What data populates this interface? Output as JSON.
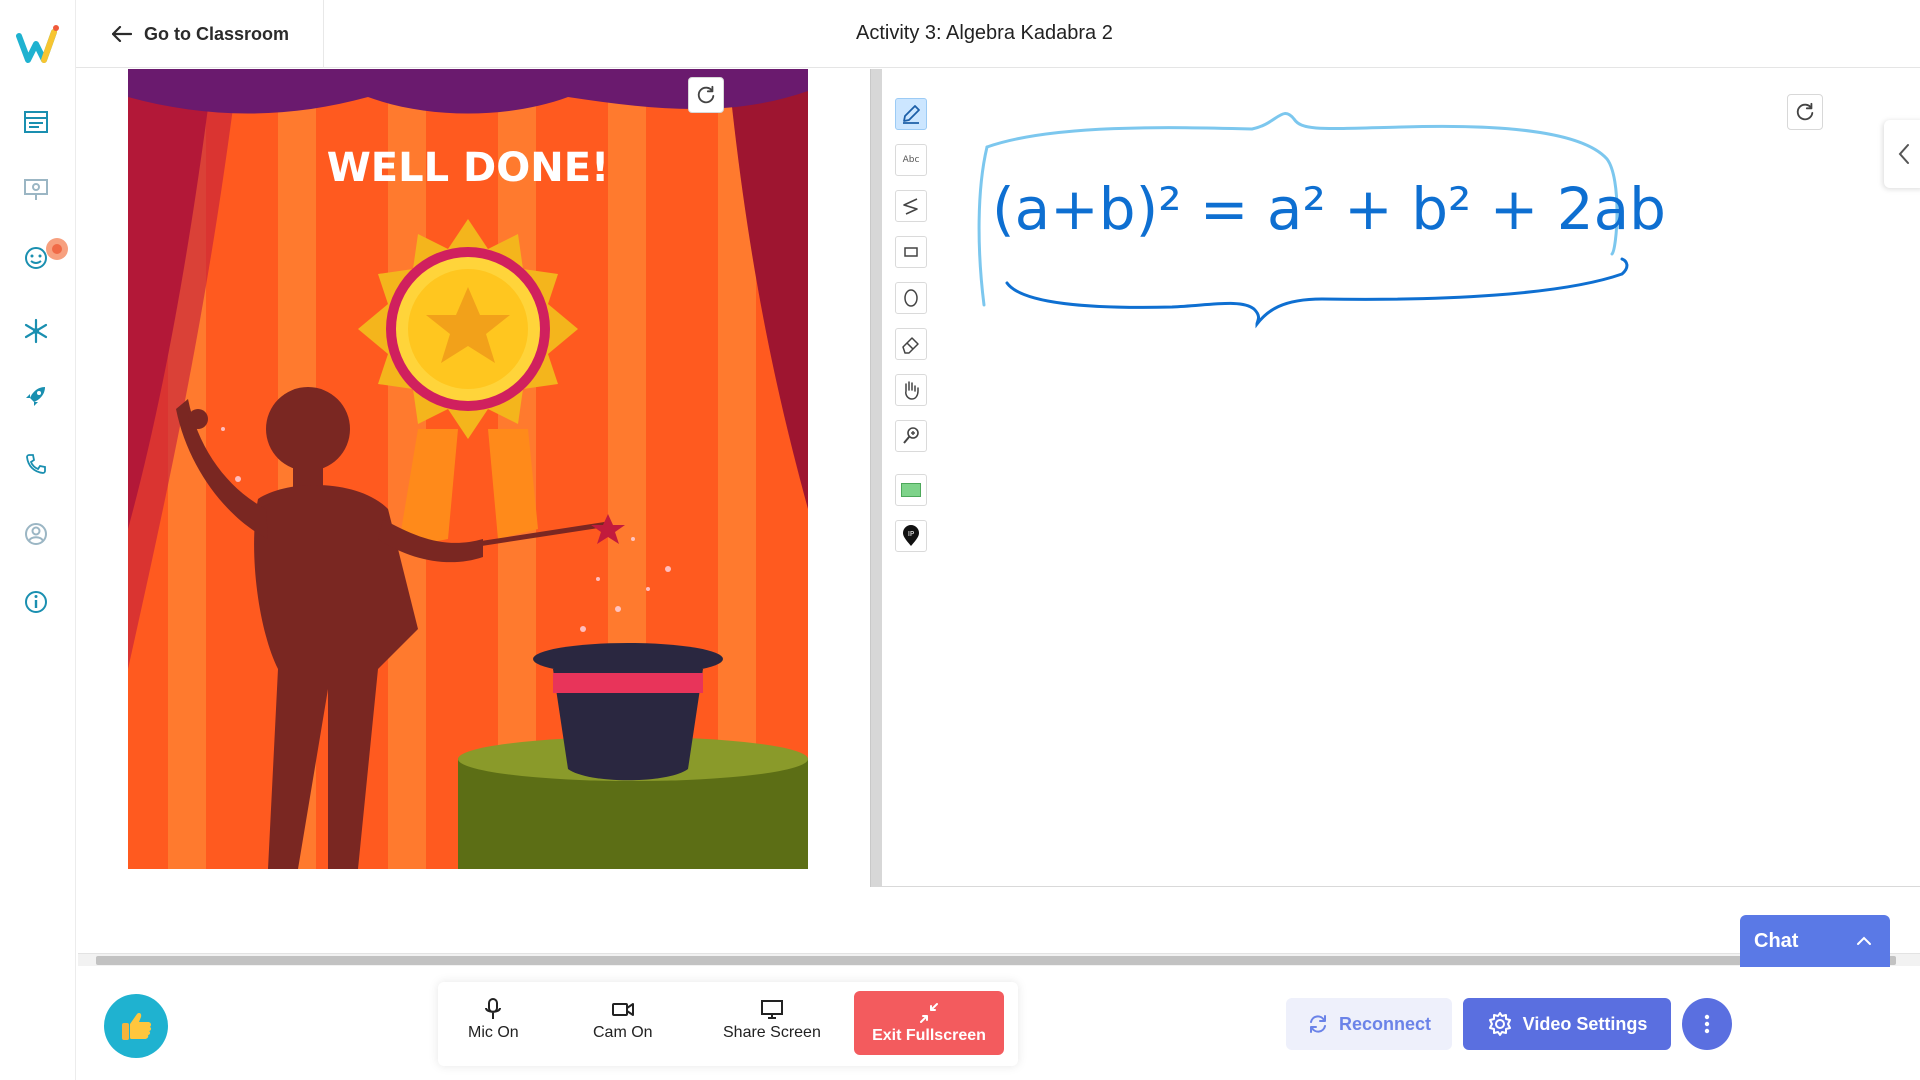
{
  "header": {
    "back_label": "Go to Classroom",
    "activity_title": "Activity 3: Algebra Kadabra 2"
  },
  "sidebar": {
    "items": [
      {
        "icon": "schedule-icon"
      },
      {
        "icon": "presentation-icon"
      },
      {
        "icon": "smiley-icon"
      },
      {
        "icon": "snowflake-icon"
      },
      {
        "icon": "rocket-icon"
      },
      {
        "icon": "phone-icon"
      },
      {
        "icon": "profile-icon"
      },
      {
        "icon": "info-icon"
      }
    ]
  },
  "activity": {
    "banner_text": "WELL DONE!"
  },
  "whiteboard": {
    "tools": [
      {
        "icon": "pencil-icon",
        "label": ""
      },
      {
        "icon": "text-tool-icon",
        "label": "Abc"
      },
      {
        "icon": "line-icon",
        "label": ""
      },
      {
        "icon": "rectangle-icon",
        "label": ""
      },
      {
        "icon": "ellipse-icon",
        "label": ""
      },
      {
        "icon": "eraser-icon",
        "label": ""
      },
      {
        "icon": "hand-icon",
        "label": ""
      },
      {
        "icon": "zoom-icon",
        "label": ""
      },
      {
        "icon": "color-swatch-icon",
        "label": ""
      },
      {
        "icon": "location-pin-icon",
        "label": "IP"
      }
    ],
    "handwritten_text": "(a+b)² = a² + b² + 2ab"
  },
  "chat": {
    "label": "Chat"
  },
  "controls": {
    "mic_label": "Mic On",
    "cam_label": "Cam On",
    "share_label": "Share Screen",
    "exit_label": "Exit Fullscreen",
    "reconnect_label": "Reconnect",
    "video_settings_label": "Video Settings"
  },
  "colors": {
    "accent": "#5a6fe0",
    "exit": "#f35b5e",
    "reaction": "#1fb2d0",
    "stage_orange": "#ff5a1f",
    "ink": "#0e6fd1"
  }
}
